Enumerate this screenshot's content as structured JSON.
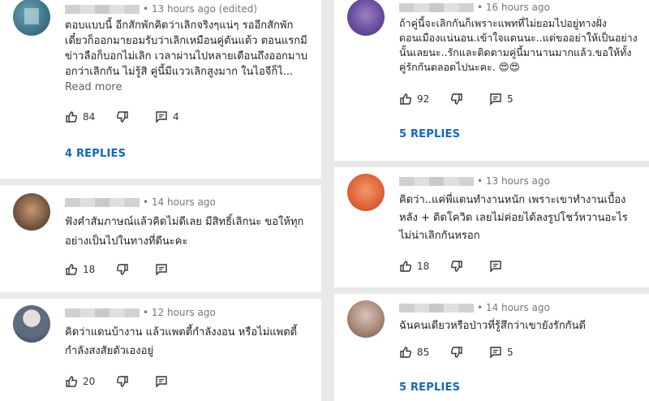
{
  "left": [
    {
      "time": "• 13 hours ago (edited)",
      "text": "ตอบแบบนี้ อีกสักพักคิดว่าเลิกจริงๆแน่ๆ รออีกสักพักเดี๋ยวก็ออกมายอมรับว่าเลิกเหมือนคู่ตันแต้ว ตอนแรกมีข่าวลือก็บอกไม่เลิก เวลาผ่านไปหลายเดือนถึงออกมาบอกว่าเลิกกัน ไม่รู้สิ คู่นี้มีแววเลิกสูงมาก ในไอจีก็ไ...",
      "read_more": "Read more",
      "likes": "84",
      "replies_count": "4",
      "replies_label": "4 REPLIES"
    },
    {
      "time": "• 14 hours ago",
      "text": "ฟังคำสัมภาษณ์แล้วคิดไม่ดีเลย มีสิทธิ์เลิกนะ ขอให้ทุกอย่างเป็นไปในทางที่ดีนะคะ",
      "likes": "18"
    },
    {
      "time": "• 12 hours ago",
      "text": "คิดว่าแดนบ้างาน แล้วแพตตี้กำลังงอน หรือไม่แพตตี้กำลังสงสัยตัวเองอยู่",
      "likes": "20"
    }
  ],
  "right": [
    {
      "time": "• 16 hours ago",
      "text": "ถ้าคู่นี้จะเลิกกันก็เพราะแพทที่ไม่ยอมไปอยู่ทางฝั่งดอนเมืองแน่นอน.เข้าใจแดนนะ..แต่ขออย่าให้เป็นอย่างนั้นเลยนะ..รักและติดตามคู่นี้มานานมากแล้ว.ขอให้ทั้งคู่รักกันตลอดไปนะคะ. 😍😍",
      "likes": "92",
      "replies_count": "5",
      "replies_label": "5 REPLIES"
    },
    {
      "time": "• 13 hours ago",
      "text": "คิดว่า..แค่พี่แดนทำงานหนัก เพราะเขาทำงานเบื้องหลัง + ติดโควิด เลยไม่ค่อยได้ลงรูปโชว์หวานอะไร ไม่น่าเลิกกันหรอก",
      "likes": "18"
    },
    {
      "time": "• 14 hours ago",
      "text": "ฉันคนเดียวหรือป่าวที่รู้สึกว่าเขายังรักกันดี",
      "likes": "85",
      "replies_count": "5",
      "replies_label": "5 REPLIES"
    }
  ],
  "colors": {
    "accent": "#1565c0",
    "meta": "#777777"
  }
}
